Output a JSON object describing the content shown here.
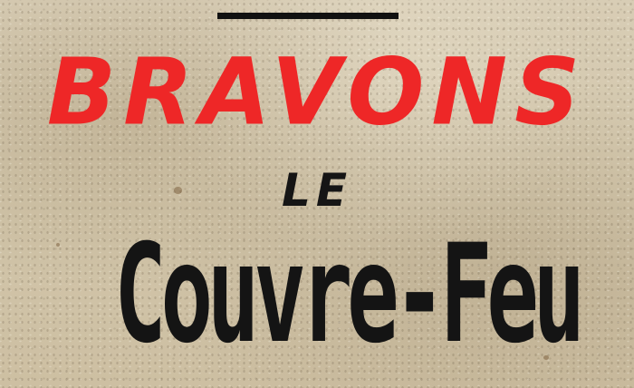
{
  "poster": {
    "line1": "BRAVONS",
    "line2": "LE",
    "line3": "Couvre-Feu"
  },
  "colors": {
    "paper": "#d4c9ae",
    "headline_red": "#ee2727",
    "ink": "#141414"
  }
}
